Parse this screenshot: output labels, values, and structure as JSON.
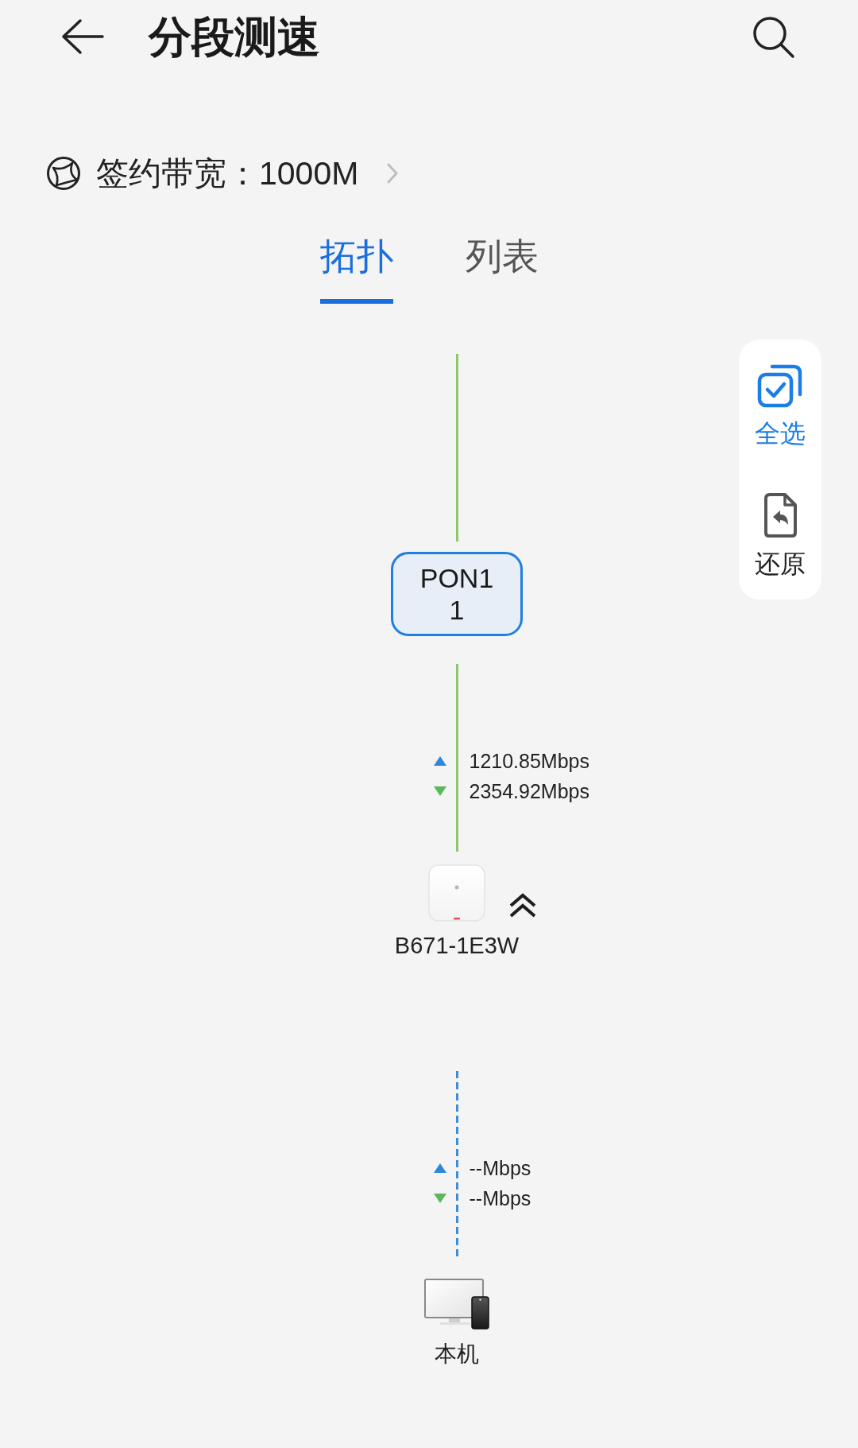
{
  "header": {
    "title": "分段测速"
  },
  "subscription": {
    "text": "签约带宽：1000M"
  },
  "tabs": [
    {
      "label": "拓扑",
      "selected": true
    },
    {
      "label": "列表",
      "selected": false
    }
  ],
  "side_actions": [
    {
      "kind": "select_all",
      "label": "全选",
      "active": true
    },
    {
      "kind": "restore",
      "label": "还原",
      "active": false
    }
  ],
  "topology": {
    "items": [
      {
        "kind": "link",
        "tested": true
      },
      {
        "kind": "port",
        "name": "PON1",
        "number": "1"
      },
      {
        "kind": "link",
        "tested": true,
        "upload": "1210.85Mbps",
        "download": "2354.92Mbps"
      },
      {
        "kind": "gateway",
        "name": "B671-1E3W",
        "expanded": true
      },
      {
        "kind": "link",
        "tested": false,
        "upload": "--Mbps",
        "download": "--Mbps"
      },
      {
        "kind": "local_device",
        "name": "本机"
      }
    ]
  }
}
